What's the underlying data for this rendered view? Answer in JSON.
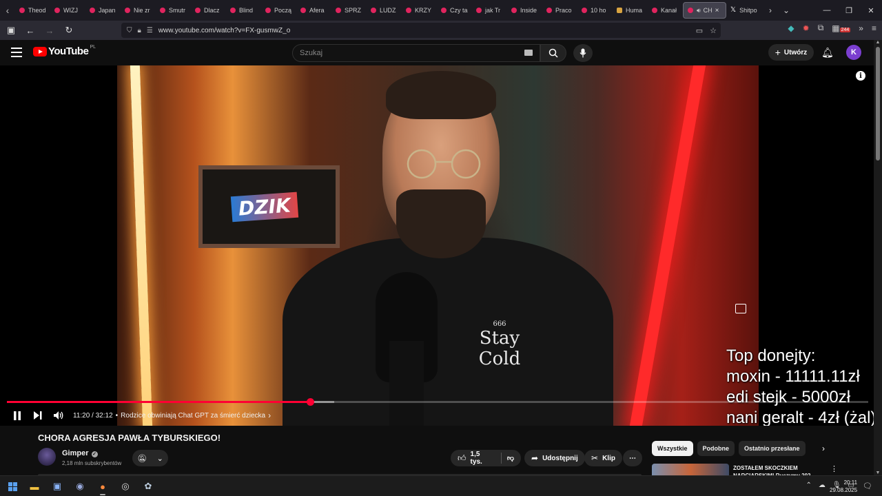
{
  "browser": {
    "tabs": [
      {
        "label": "Theod",
        "icon": "youtube-icon"
      },
      {
        "label": "WIZJ",
        "icon": "youtube-icon"
      },
      {
        "label": "Japan",
        "icon": "youtube-icon"
      },
      {
        "label": "Nie zr",
        "icon": "youtube-icon"
      },
      {
        "label": "Smutr",
        "icon": "youtube-icon"
      },
      {
        "label": "Dlacz",
        "icon": "youtube-icon"
      },
      {
        "label": "Blind",
        "icon": "youtube-icon"
      },
      {
        "label": "Począ",
        "icon": "youtube-icon"
      },
      {
        "label": "Afera",
        "icon": "youtube-icon"
      },
      {
        "label": "SPRZ",
        "icon": "youtube-icon"
      },
      {
        "label": "LUDZ",
        "icon": "youtube-icon"
      },
      {
        "label": "KRZY",
        "icon": "youtube-icon"
      },
      {
        "label": "Czy ta",
        "icon": "youtube-icon"
      },
      {
        "label": "jak Tr",
        "icon": "youtube-icon"
      },
      {
        "label": "Inside",
        "icon": "youtube-icon"
      },
      {
        "label": "Praco",
        "icon": "youtube-icon"
      },
      {
        "label": "10 ho",
        "icon": "youtube-icon"
      },
      {
        "label": "Huma",
        "icon": "humble-icon"
      },
      {
        "label": "Kanał",
        "icon": "youtube-icon"
      }
    ],
    "active_tab": {
      "label": "CH",
      "icon": "youtube-icon",
      "close": "×"
    },
    "extra_tabs": [
      {
        "label": "Shitpo",
        "icon": "x-icon"
      }
    ],
    "url": "www.youtube.com/watch?v=FX-gusmwZ_o",
    "nav_badge": "244"
  },
  "youtube": {
    "logo_text": "YouTube",
    "country_code": "PL",
    "search_placeholder": "Szukaj",
    "create_label": "Utwórz",
    "avatar_letter": "K"
  },
  "player": {
    "overlay_text": {
      "line1": "Top donejty:",
      "line2": "moxin - 11111.11zł",
      "line3": "edi stejk - 5000zł",
      "line4": "nani geralt - 4zł (żal)"
    },
    "sign_text": "DZIK",
    "shirt_num": "666",
    "shirt_text": "Stay Cold",
    "timecode": "11:20 / 32:12",
    "chapter_sep": "•",
    "chapter": "Rodzice obwiniają Chat GPT za śmierć dziecka",
    "chapter_chevron": "›",
    "progress_fraction": 0.352,
    "buffer_fraction": 0.38,
    "accent_color": "#ff0033"
  },
  "video": {
    "title": "CHORA AGRESJA PAWŁA TYBURSKIEGO!",
    "channel": "Gimper",
    "subscribers": "2,18 mln subskrybentów",
    "likes": "1,5 tys.",
    "share_label": "Udostępnij",
    "clip_label": "Klip"
  },
  "recommendations": {
    "chips": [
      "Wszystkie",
      "Podobne",
      "Ostatnio przesłane"
    ],
    "first_title": "ZOSTAŁEM SKOCZKIEM NARCIARSKIM! Ruszymy 202"
  },
  "taskbar": {
    "time": "20:11",
    "date": "29.08.2025"
  }
}
